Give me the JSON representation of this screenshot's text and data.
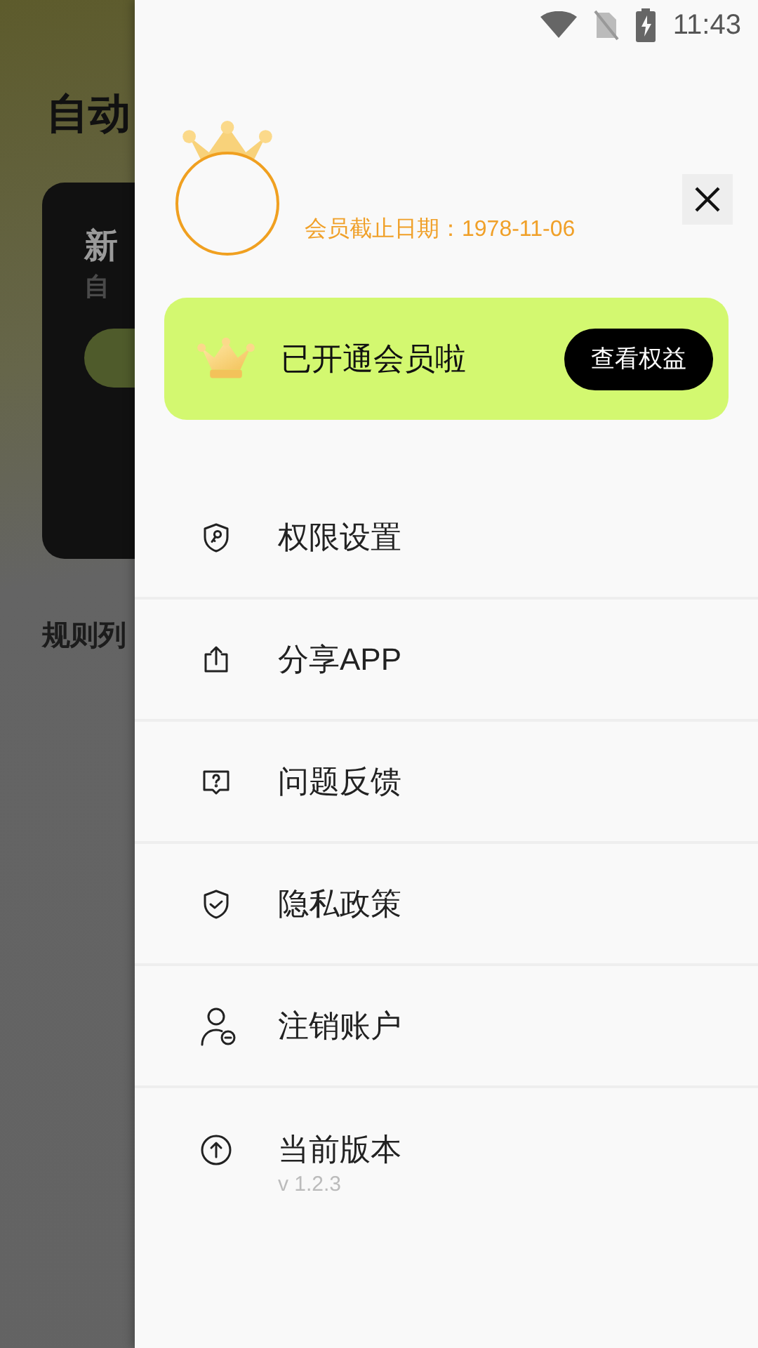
{
  "background_app": {
    "title": "自动",
    "card": {
      "title": "新",
      "subtitle": "自"
    },
    "section_title": "规则列"
  },
  "status_bar": {
    "time": "11:43"
  },
  "drawer": {
    "membership_expiry": "会员截止日期：1978-11-06",
    "member_banner": {
      "text": "已开通会员啦",
      "button": "查看权益"
    },
    "menu": [
      {
        "kind": "permission",
        "label": "权限设置"
      },
      {
        "kind": "share",
        "label": "分享APP"
      },
      {
        "kind": "feedback",
        "label": "问题反馈"
      },
      {
        "kind": "privacy",
        "label": "隐私政策"
      },
      {
        "kind": "account",
        "label": "注销账户"
      },
      {
        "kind": "version",
        "label": "当前版本",
        "subtitle": "v 1.2.3"
      }
    ]
  }
}
